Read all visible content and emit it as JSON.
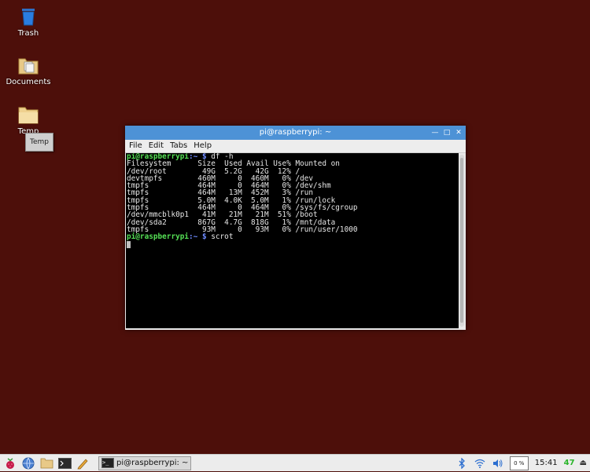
{
  "desktop": {
    "icons": [
      {
        "label": "Trash"
      },
      {
        "label": "Documents"
      },
      {
        "label": "Temp"
      }
    ],
    "tooltip": "Temp"
  },
  "window": {
    "title": "pi@raspberrypi: ~",
    "controls": {
      "minimize": "—",
      "maximize": "□",
      "close": "✕"
    },
    "menu": [
      "File",
      "Edit",
      "Tabs",
      "Help"
    ],
    "terminal": {
      "prompt_user": "pi@raspberrypi",
      "prompt_path": ":~ $",
      "command1": " df -h",
      "header": "Filesystem      Size  Used Avail Use% Mounted on",
      "rows": [
        "/dev/root        49G  5.2G   42G  12% /",
        "devtmpfs        460M     0  460M   0% /dev",
        "tmpfs           464M     0  464M   0% /dev/shm",
        "tmpfs           464M   13M  452M   3% /run",
        "tmpfs           5.0M  4.0K  5.0M   1% /run/lock",
        "tmpfs           464M     0  464M   0% /sys/fs/cgroup",
        "/dev/mmcblk0p1   41M   21M   21M  51% /boot",
        "/dev/sda2       867G  4.7G  818G   1% /mnt/data",
        "tmpfs            93M     0   93M   0% /run/user/1000"
      ],
      "command2": " scrot"
    }
  },
  "taskbar": {
    "task_label": "pi@raspberrypi: ~",
    "cpu": "0 %",
    "clock": "15:41",
    "temperature": "47"
  },
  "colors": {
    "desktop_bg": "#4d0f0a",
    "titlebar": "#4d92d6",
    "prompt_user": "#55e055",
    "prompt_path": "#6e8bff"
  }
}
